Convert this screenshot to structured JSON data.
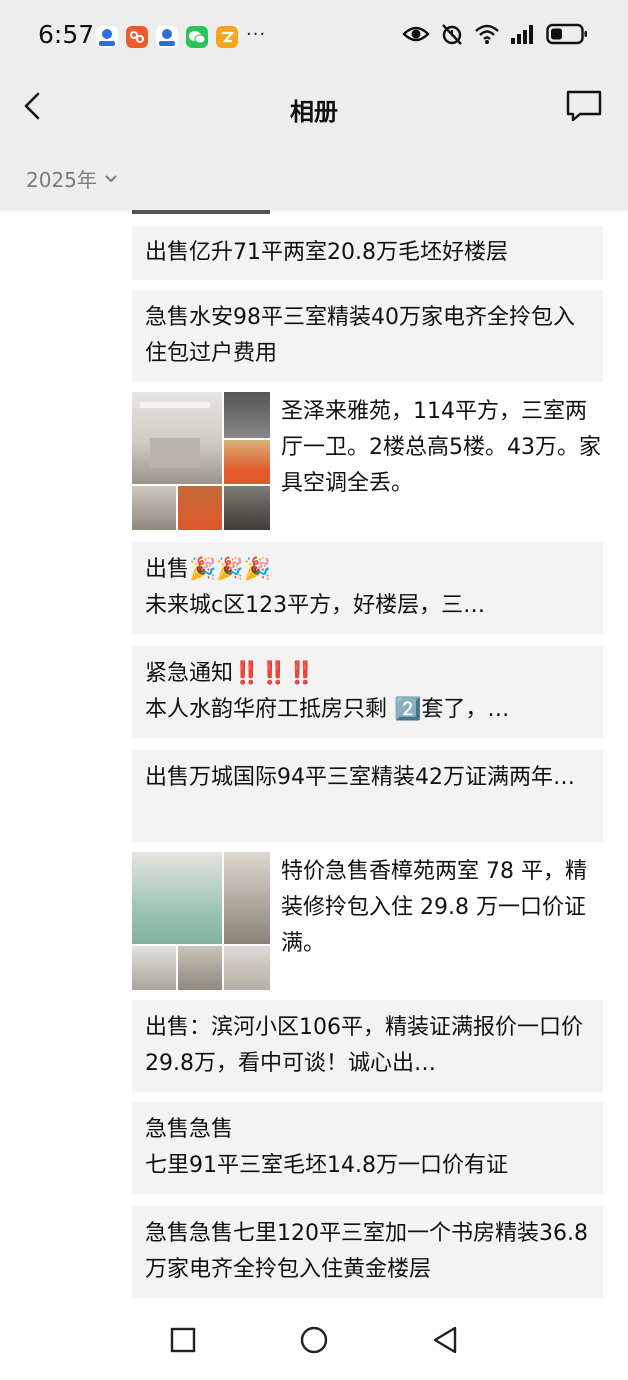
{
  "status_bar": {
    "time": "6:57",
    "more_indicator": "···",
    "notification_icons": [
      "app-icon-blue",
      "app-icon-orange",
      "app-icon-blue",
      "wechat-icon",
      "app-icon-yellow"
    ],
    "system_icons": [
      "eye-icon",
      "alarm-icon",
      "wifi-icon",
      "signal-icon",
      "battery-icon"
    ]
  },
  "header": {
    "title": "相册",
    "back_icon": "back-arrow-icon",
    "message_icon": "message-bubble-icon"
  },
  "year_filter": {
    "label": "2025年",
    "icon": "chevron-down-icon"
  },
  "posts": [
    {
      "type": "text",
      "text": "出售亿升71平两室20.8万毛坯好楼层"
    },
    {
      "type": "text",
      "text": "急售水安98平三室精装40万家电齐全拎包入住包过户费用"
    },
    {
      "type": "image",
      "text": "圣泽来雅苑，114平方，三室两厅一卫。2楼总高5楼。43万。家具空调全丢。"
    },
    {
      "type": "text",
      "line1": "出售🎉🎉🎉",
      "line2": "未来城c区123平方，好楼层，三…"
    },
    {
      "type": "text",
      "line1": "紧急通知‼️‼️‼️",
      "line2": "本人水韵华府工抵房只剩 2️⃣套了，…"
    },
    {
      "type": "text",
      "text": "出售万城国际94平三室精装42万证满两年…"
    },
    {
      "type": "image",
      "text": "特价急售香樟苑两室 78 平，精装修拎包入住 29.8 万一口价证满。"
    },
    {
      "type": "text",
      "text": "出售：滨河小区106平，精装证满报价一口价29.8万，看中可谈！诚心出…"
    },
    {
      "type": "text",
      "line1": "急售急售",
      "line2": "七里91平三室毛坯14.8万一口价有证"
    },
    {
      "type": "text",
      "text": "急售急售七里120平三室加一个书房精装36.8万家电齐全拎包入住黄金楼层"
    }
  ],
  "system_nav": {
    "buttons": [
      "square-recent-icon",
      "circle-home-icon",
      "triangle-back-icon"
    ]
  }
}
